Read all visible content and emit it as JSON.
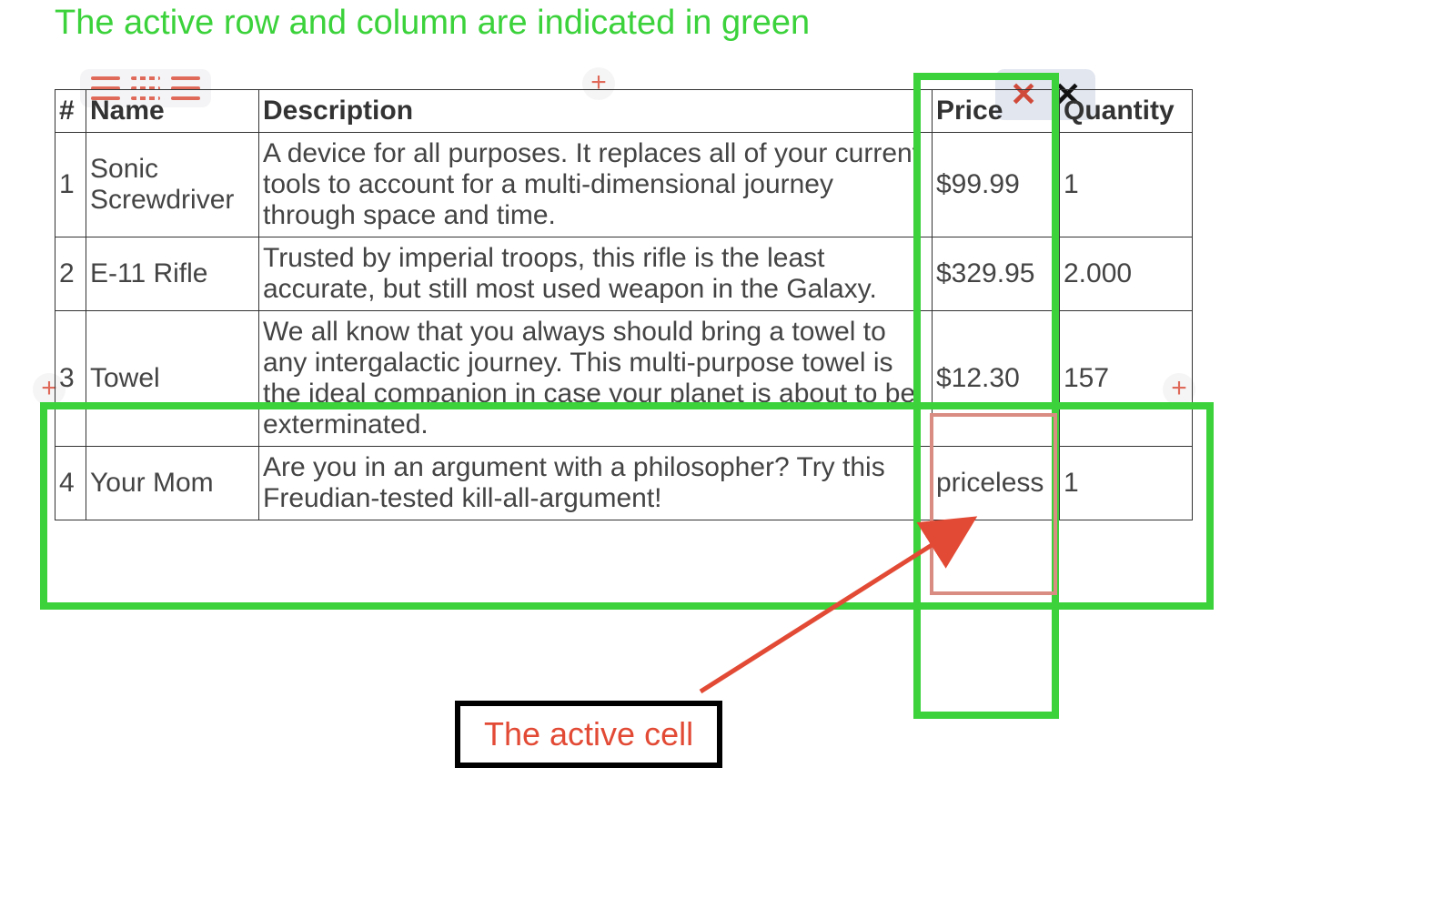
{
  "title": "The active row and column are indicated in green",
  "active_cell_label": "The active cell",
  "columns": {
    "num": "#",
    "name": "Name",
    "desc": "Description",
    "price": "Price",
    "qty": "Quantity"
  },
  "rows": [
    {
      "num": "1",
      "name": "Sonic Screwdriver",
      "desc": "A device for all purposes. It replaces all of your current tools to account for a multi-dimensional journey through space and time.",
      "price": "$99.99",
      "qty": "1"
    },
    {
      "num": "2",
      "name": "E-11 Rifle",
      "desc": "Trusted by imperial troops, this rifle is the least accurate, but still most used weapon in the Galaxy.",
      "price": "$329.95",
      "qty": "2.000"
    },
    {
      "num": "3",
      "name": "Towel",
      "desc": "We all know that you always should bring a towel to any intergalactic journey. This multi-purpose towel is the ideal companion in case your planet is about to be exterminated.",
      "price": "$12.30",
      "qty": "157"
    },
    {
      "num": "4",
      "name": "Your Mom",
      "desc": "Are you in an argument with a philosopher? Try this Freudian-tested kill-all-argument!",
      "price": "priceless",
      "qty": "1"
    }
  ],
  "toolbar": {
    "plus": "+",
    "delete_row": "✕",
    "delete_col": "✕"
  },
  "highlight": {
    "active_row_index": 2,
    "active_col_key": "price"
  },
  "colors": {
    "green": "#3bd23b",
    "red": "#e24a35",
    "red_soft": "#d98c82"
  }
}
